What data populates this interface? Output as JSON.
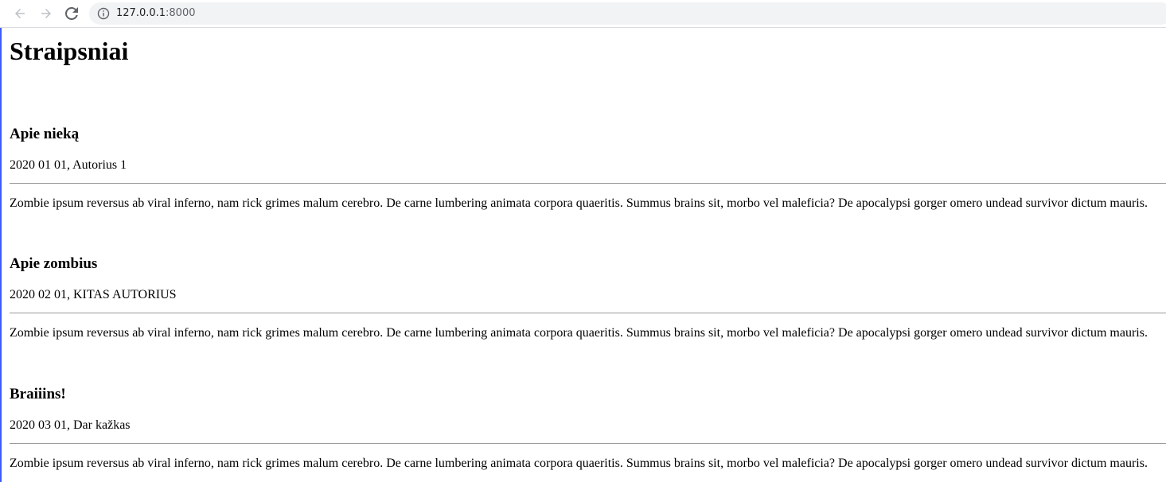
{
  "browser": {
    "url_host": "127.0.0.1",
    "url_port": ":8000"
  },
  "page": {
    "title": "Straipsniai"
  },
  "articles": [
    {
      "title": "Apie nieką",
      "meta": "2020 01 01, Autorius 1",
      "body": "Zombie ipsum reversus ab viral inferno, nam rick grimes malum cerebro. De carne lumbering animata corpora quaeritis. Summus brains sit, morbo vel maleficia? De apocalypsi gorger omero undead survivor dictum mauris."
    },
    {
      "title": "Apie zombius",
      "meta": "2020 02 01, KITAS AUTORIUS",
      "body": "Zombie ipsum reversus ab viral inferno, nam rick grimes malum cerebro. De carne lumbering animata corpora quaeritis. Summus brains sit, morbo vel maleficia? De apocalypsi gorger omero undead survivor dictum mauris."
    },
    {
      "title": "Braiiins!",
      "meta": "2020 03 01, Dar kažkas",
      "body": "Zombie ipsum reversus ab viral inferno, nam rick grimes malum cerebro. De carne lumbering animata corpora quaeritis. Summus brains sit, morbo vel maleficia? De apocalypsi gorger omero undead survivor dictum mauris."
    }
  ]
}
